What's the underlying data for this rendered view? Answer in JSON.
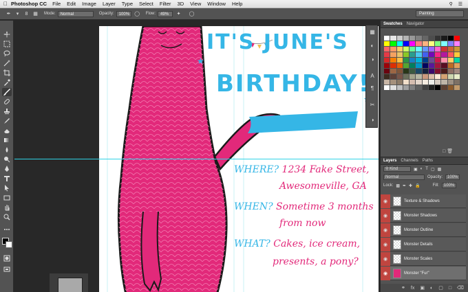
{
  "menubar": {
    "app": "Photoshop CC",
    "items": [
      "File",
      "Edit",
      "Image",
      "Layer",
      "Type",
      "Select",
      "Filter",
      "3D",
      "View",
      "Window",
      "Help"
    ]
  },
  "options": {
    "mode_label": "Mode:",
    "mode_value": "Normal",
    "opacity_label": "Opacity:",
    "opacity_value": "100%",
    "flow_label": "Flow:",
    "flow_value": "49%",
    "workspace": "Painting",
    "brush_size": "8"
  },
  "artwork": {
    "headline_line1": "IT'S JUNE'S",
    "headline_line2": "BIRTHDAY!",
    "where_q": "WHERE?",
    "where_a1": "1234 Fake Street,",
    "where_a2": "Awesomeville, GA",
    "when_q": "WHEN?",
    "when_a1": "Sometime 3 months",
    "when_a2": "from now",
    "what_q": "WHAT?",
    "what_a1": "Cakes, ice cream,",
    "what_a2": "presents, a pony?"
  },
  "swatches_panel": {
    "tab_active": "Swatches",
    "tab_other": "Navigator",
    "colors": [
      "#ffffff",
      "#e6e6e6",
      "#cccccc",
      "#b3b3b3",
      "#999999",
      "#808080",
      "#666666",
      "#4d4d4d",
      "#333333",
      "#1a1a1a",
      "#000000",
      "#ff0000",
      "#ffff00",
      "#00ff00",
      "#00ffff",
      "#0000ff",
      "#ff00ff",
      "#ff8080",
      "#ffb380",
      "#ffff80",
      "#80ff80",
      "#80ffff",
      "#8080ff",
      "#ff80ff",
      "#ff6666",
      "#ff9966",
      "#ffcc66",
      "#ccff66",
      "#66ff99",
      "#66ffff",
      "#6699ff",
      "#9966ff",
      "#ff66cc",
      "#cc3333",
      "#cc6633",
      "#cc9933",
      "#e63946",
      "#f4a261",
      "#e9c46a",
      "#8ac926",
      "#2a9d8f",
      "#4cc9f0",
      "#4361ee",
      "#7209b7",
      "#f72585",
      "#b5179e",
      "#ff595e",
      "#ffca3a",
      "#d62828",
      "#f77f00",
      "#fcbf49",
      "#2b9348",
      "#1982c4",
      "#00b4d8",
      "#023e8a",
      "#6a4c93",
      "#c9184a",
      "#ff8fab",
      "#ffd166",
      "#06d6a0",
      "#9d0208",
      "#dc2f02",
      "#e85d04",
      "#55a630",
      "#007f5f",
      "#0096c7",
      "#03045e",
      "#5a189a",
      "#a4133c",
      "#590d22",
      "#bc6c25",
      "#dda15e",
      "#6a040f",
      "#9c6644",
      "#7f5539",
      "#283618",
      "#3a5a40",
      "#1b4965",
      "#14213d",
      "#3c096c",
      "#800f2f",
      "#4a1c1c",
      "#8d6e63",
      "#a1887f",
      "#3d2b1f",
      "#5d4037",
      "#795548",
      "#6b705c",
      "#a5a58d",
      "#b7b7a4",
      "#cb997e",
      "#ddbea9",
      "#ffe8d6",
      "#d4a373",
      "#ccd5ae",
      "#e9edc9",
      "#c8b6a6",
      "#a4907c",
      "#8d7b68",
      "#f1dec9",
      "#d5bdaf",
      "#e3d5ca",
      "#f5ebe0",
      "#edede9",
      "#d6ccc2",
      "#bfb5a8",
      "#9e9184",
      "#7d7064",
      "#ffffff",
      "#e0e0e0",
      "#c0c0c0",
      "#a0a0a0",
      "#808080",
      "#606060",
      "#404040",
      "#202020",
      "#000000",
      "#5c4033",
      "#8b5a2b",
      "#c19a6b"
    ]
  },
  "layers_panel": {
    "tabs": [
      "Layers",
      "Channels",
      "Paths"
    ],
    "kind_label": "Kind",
    "blend_mode": "Normal",
    "opacity_label": "Opacity:",
    "opacity_value": "100%",
    "lock_label": "Lock:",
    "fill_label": "Fill:",
    "fill_value": "100%",
    "layers": [
      {
        "name": "Texture & Shadows"
      },
      {
        "name": "Monster Shadows"
      },
      {
        "name": "Monster Outline"
      },
      {
        "name": "Monster Details"
      },
      {
        "name": "Monster Scales"
      },
      {
        "name": "Monster \"Fur\""
      }
    ]
  },
  "colors": {
    "pink": "#e2297a",
    "blue": "#35b6e6",
    "layer_red": "#c0453f"
  }
}
